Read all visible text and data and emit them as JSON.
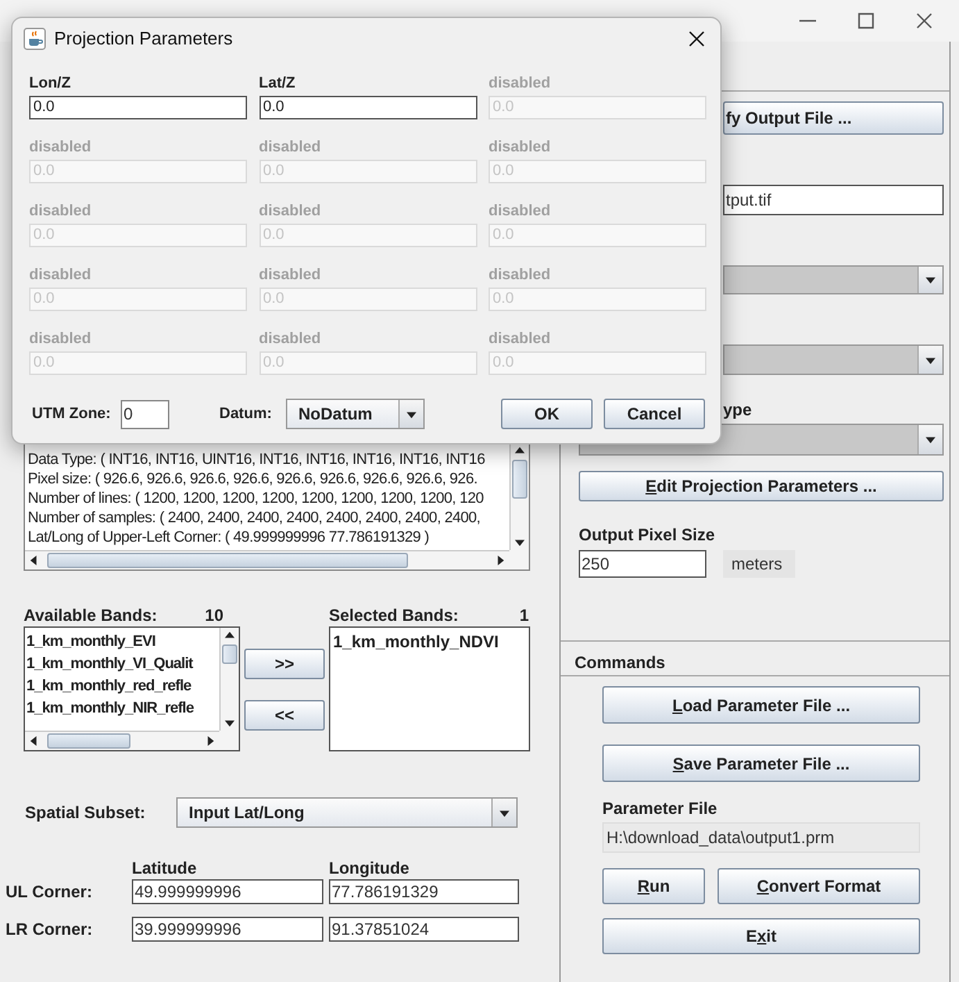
{
  "dialog": {
    "title": "Projection Parameters",
    "fields": [
      {
        "label": "Lon/Z",
        "value": "0.0",
        "disabled": false
      },
      {
        "label": "Lat/Z",
        "value": "0.0",
        "disabled": false
      },
      {
        "label": "disabled",
        "value": "0.0",
        "disabled": true
      },
      {
        "label": "disabled",
        "value": "0.0",
        "disabled": true
      },
      {
        "label": "disabled",
        "value": "0.0",
        "disabled": true
      },
      {
        "label": "disabled",
        "value": "0.0",
        "disabled": true
      },
      {
        "label": "disabled",
        "value": "0.0",
        "disabled": true
      },
      {
        "label": "disabled",
        "value": "0.0",
        "disabled": true
      },
      {
        "label": "disabled",
        "value": "0.0",
        "disabled": true
      },
      {
        "label": "disabled",
        "value": "0.0",
        "disabled": true
      },
      {
        "label": "disabled",
        "value": "0.0",
        "disabled": true
      },
      {
        "label": "disabled",
        "value": "0.0",
        "disabled": true
      },
      {
        "label": "disabled",
        "value": "0.0",
        "disabled": true
      },
      {
        "label": "disabled",
        "value": "0.0",
        "disabled": true
      },
      {
        "label": "disabled",
        "value": "0.0",
        "disabled": true
      }
    ],
    "utm_zone": {
      "label": "UTM Zone:",
      "value": "0"
    },
    "datum": {
      "label": "Datum:",
      "value": "NoDatum"
    },
    "buttons": [
      {
        "label": "OK"
      },
      {
        "label": "Cancel"
      }
    ]
  },
  "info_lines": [
    "Data Type: ( INT16, INT16, UINT16, INT16, INT16, INT16, INT16, INT16",
    "Pixel size: ( 926.6, 926.6, 926.6, 926.6, 926.6, 926.6, 926.6, 926.6, 926.",
    "Number of lines: ( 1200, 1200, 1200, 1200, 1200, 1200, 1200, 1200, 120",
    "Number of samples: ( 2400, 2400, 2400, 2400, 2400, 2400, 2400, 2400,",
    "Lat/Long of Upper-Left Corner: ( 49.999999996 77.786191329 )"
  ],
  "available_bands": {
    "label": "Available Bands:",
    "count": "10",
    "items": [
      "1_km_monthly_EVI",
      "1_km_monthly_VI_Qualit",
      "1_km_monthly_red_refle",
      "1_km_monthly_NIR_refle"
    ]
  },
  "move_buttons": [
    ">>",
    "<<"
  ],
  "selected_bands": {
    "label": "Selected Bands:",
    "count": "1",
    "items": [
      "1_km_monthly_NDVI"
    ]
  },
  "spatial_subset": {
    "label": "Spatial Subset:",
    "value": "Input Lat/Long"
  },
  "corners": {
    "columns": [
      "Latitude",
      "Longitude"
    ],
    "rows": [
      {
        "label": "UL Corner:",
        "values": [
          "49.999999996",
          "77.786191329"
        ]
      },
      {
        "label": "LR Corner:",
        "values": [
          "39.999999996",
          "91.37851024"
        ]
      }
    ]
  },
  "output": {
    "button": "fy Output File ...",
    "file": "tput.tif",
    "type_label": "ype",
    "edit_button": {
      "mnemonic": "E",
      "rest": "dit Projection Parameters ..."
    },
    "pixel_size": {
      "label": "Output Pixel Size",
      "value": "250",
      "unit": "meters"
    }
  },
  "commands": {
    "title": "Commands",
    "buttons": [
      {
        "mnemonic": "L",
        "rest": "oad Parameter File ..."
      },
      {
        "mnemonic": "S",
        "rest": "ave Parameter File ..."
      }
    ],
    "parameter_file": {
      "label": "Parameter File",
      "value": "H:\\download_data\\output1.prm"
    },
    "run": {
      "mnemonic": "R",
      "rest": "un"
    },
    "convert": {
      "mnemonic": "C",
      "rest": "onvert Format"
    },
    "exit": {
      "lead": "E",
      "mnemonic": "x",
      "rest": "it"
    }
  }
}
